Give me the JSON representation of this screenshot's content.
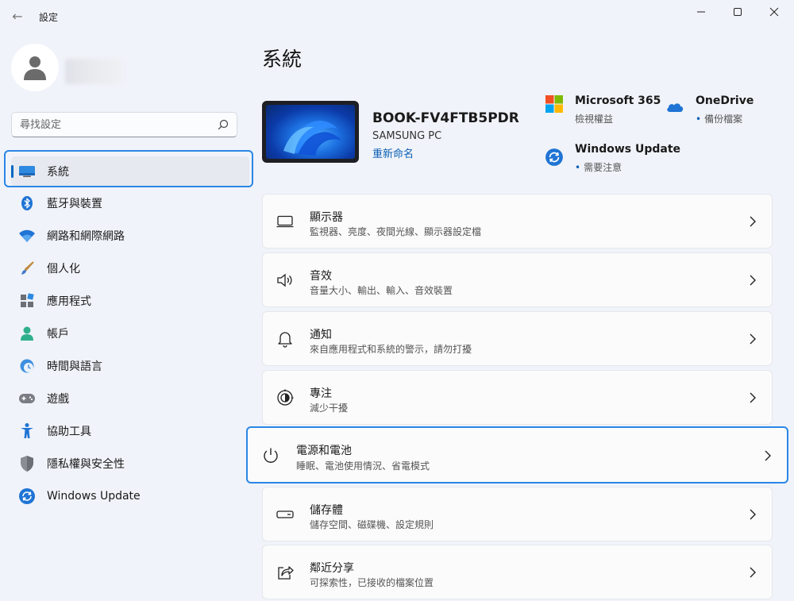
{
  "window": {
    "back_glyph": "←",
    "title": "設定"
  },
  "search": {
    "placeholder": "尋找設定"
  },
  "nav": {
    "items": [
      {
        "label": "系統",
        "icon": "system-icon"
      },
      {
        "label": "藍牙與裝置",
        "icon": "bluetooth-icon"
      },
      {
        "label": "網路和網際網路",
        "icon": "wifi-icon"
      },
      {
        "label": "個人化",
        "icon": "brush-icon"
      },
      {
        "label": "應用程式",
        "icon": "apps-icon"
      },
      {
        "label": "帳戶",
        "icon": "account-icon"
      },
      {
        "label": "時間與語言",
        "icon": "clock-globe-icon"
      },
      {
        "label": "遊戲",
        "icon": "gamepad-icon"
      },
      {
        "label": "協助工具",
        "icon": "accessibility-icon"
      },
      {
        "label": "隱私權與安全性",
        "icon": "shield-icon"
      },
      {
        "label": "Windows Update",
        "icon": "windows-update-icon"
      }
    ]
  },
  "main": {
    "title": "系統",
    "device": {
      "name": "BOOK-FV4FTB5PDR",
      "model": "SAMSUNG PC",
      "rename": "重新命名"
    },
    "quick": {
      "m365": {
        "title": "Microsoft 365",
        "sub": "檢視權益"
      },
      "onedrive": {
        "title": "OneDrive",
        "sub": "備份檔案",
        "dot": "•"
      },
      "update": {
        "title": "Windows Update",
        "sub": "需要注意",
        "dot": "•"
      }
    },
    "cards": [
      {
        "title": "顯示器",
        "sub": "監視器、亮度、夜間光線、顯示器設定檔",
        "icon": "display-icon"
      },
      {
        "title": "音效",
        "sub": "音量大小、輸出、輸入、音效裝置",
        "icon": "speaker-icon"
      },
      {
        "title": "通知",
        "sub": "來自應用程式和系統的警示，請勿打擾",
        "icon": "bell-icon"
      },
      {
        "title": "專注",
        "sub": "減少干擾",
        "icon": "focus-icon"
      },
      {
        "title": "電源和電池",
        "sub": "睡眠、電池使用情況、省電模式",
        "icon": "power-icon"
      },
      {
        "title": "儲存體",
        "sub": "儲存空間、磁碟機、設定規則",
        "icon": "storage-icon"
      },
      {
        "title": "鄰近分享",
        "sub": "可探索性，已接收的檔案位置",
        "icon": "share-icon"
      }
    ]
  },
  "colors": {
    "accent": "#0067c0",
    "highlight": "#2a86e6",
    "background": "#f0f3f9"
  }
}
